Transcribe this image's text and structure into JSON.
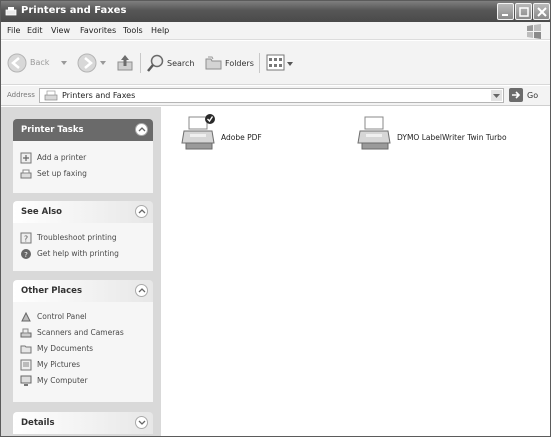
{
  "window": {
    "title": "Printers and Faxes"
  },
  "menu": [
    "File",
    "Edit",
    "View",
    "Favorites",
    "Tools",
    "Help"
  ],
  "toolbar": {
    "back_label": "Back",
    "search_label": "Search",
    "folders_label": "Folders"
  },
  "address": {
    "label": "Address",
    "value": "Printers and Faxes",
    "go_label": "Go"
  },
  "panels": {
    "printer_tasks": {
      "title": "Printer Tasks",
      "items": [
        "Add a printer",
        "Set up faxing"
      ]
    },
    "see_also": {
      "title": "See Also",
      "items": [
        "Troubleshoot printing",
        "Get help with printing"
      ]
    },
    "other_places": {
      "title": "Other Places",
      "items": [
        "Control Panel",
        "Scanners and Cameras",
        "My Documents",
        "My Pictures",
        "My Computer"
      ]
    },
    "details": {
      "title": "Details"
    }
  },
  "printers": [
    {
      "name": "Adobe PDF",
      "default": true
    },
    {
      "name": "DYMO LabelWriter Twin Turbo",
      "default": false
    }
  ]
}
